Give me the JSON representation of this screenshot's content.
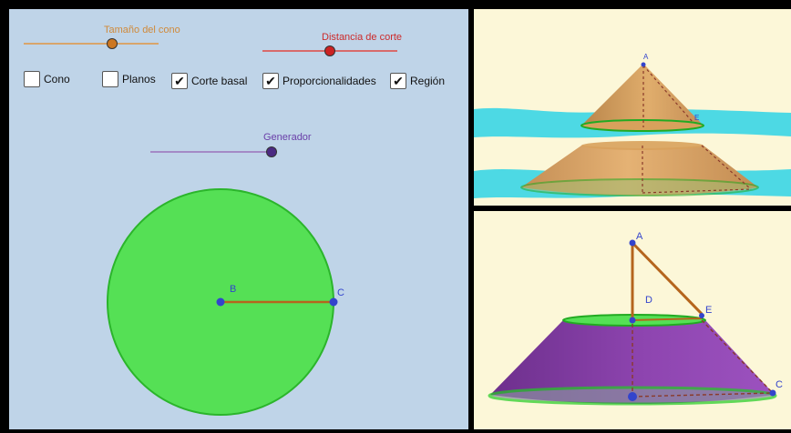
{
  "sliders": {
    "cone_size": {
      "label": "Tamaño del cono",
      "color": "#cc7722",
      "value": 0.55
    },
    "cut_distance": {
      "label": "Distancia de corte",
      "color": "#cc2222",
      "value": 0.48
    },
    "generator": {
      "label": "Generador",
      "color": "#663399",
      "value": 0.98
    }
  },
  "checkboxes": [
    {
      "label": "Cono",
      "checked": false,
      "mark": ""
    },
    {
      "label": "Planos",
      "checked": false,
      "mark": ""
    },
    {
      "label": "Corte basal",
      "checked": true,
      "mark": "✔"
    },
    {
      "label": "Proporcionalidades",
      "checked": true,
      "mark": "✔"
    },
    {
      "label": "Región",
      "checked": true,
      "mark": "✔"
    }
  ],
  "circle_view": {
    "points": {
      "B": "B",
      "C": "C"
    },
    "fill": "#55e055",
    "radius_color": "#b5651d",
    "point_color": "#3344cc"
  },
  "cone_view": {
    "points": {
      "A": "A",
      "E": "E"
    },
    "cone_color": "#d8a15c",
    "plane_color": "#2ed3e6"
  },
  "frustum_view": {
    "points": {
      "A": "A",
      "D": "D",
      "E": "E",
      "C": "C"
    },
    "frustum_color": "#8a3fa8",
    "base_color": "#55e055",
    "line_color": "#b5651d"
  }
}
